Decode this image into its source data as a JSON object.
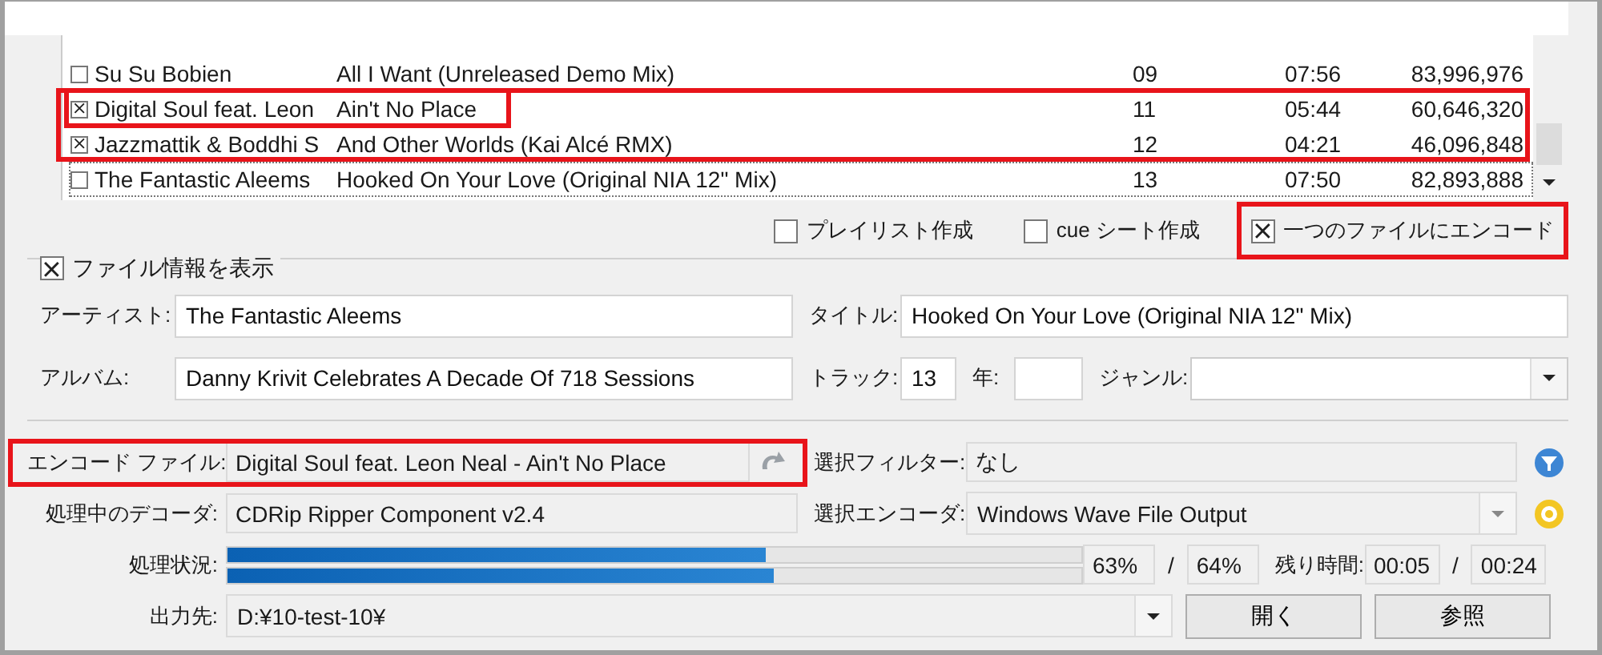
{
  "tracks": [
    {
      "checked": false,
      "marked": false,
      "emphasized": false,
      "focused": false,
      "artist": "Su Su Bobien",
      "title": "All I Want (Unreleased Demo Mix)",
      "track": "09",
      "time": "07:56",
      "size": "83,996,976"
    },
    {
      "checked": true,
      "marked": true,
      "emphasized": true,
      "focused": false,
      "artist": "Digital Soul feat. Leon",
      "title": "Ain't No Place",
      "track": "11",
      "time": "05:44",
      "size": "60,646,320"
    },
    {
      "checked": true,
      "marked": true,
      "emphasized": false,
      "focused": false,
      "artist": "Jazzmattik & Boddhi S",
      "title": "And Other Worlds (Kai Alcé RMX)",
      "track": "12",
      "time": "04:21",
      "size": "46,096,848"
    },
    {
      "checked": false,
      "marked": false,
      "emphasized": false,
      "focused": true,
      "artist": "The Fantastic Aleems",
      "title": "Hooked On Your Love (Original NIA 12\" Mix)",
      "track": "13",
      "time": "07:50",
      "size": "82,893,888"
    }
  ],
  "options": [
    {
      "label": "プレイリスト作成",
      "checked": false,
      "marked": false
    },
    {
      "label": "cue シート作成",
      "checked": false,
      "marked": false
    },
    {
      "label": "一つのファイルにエンコード",
      "checked": true,
      "marked": true
    }
  ],
  "file_info": {
    "label": "ファイル情報を表示",
    "checked": true,
    "artist": {
      "label": "アーティスト:",
      "value": "The Fantastic Aleems"
    },
    "title": {
      "label": "タイトル:",
      "value": "Hooked On Your Love (Original NIA 12\" Mix)"
    },
    "album": {
      "label": "アルバム:",
      "value": "Danny Krivit Celebrates A Decade Of 718 Sessions"
    },
    "track": {
      "label": "トラック:",
      "value": "13"
    },
    "year": {
      "label": "年:"
    },
    "genre": {
      "label": "ジャンル:"
    }
  },
  "encode_file": {
    "label": "エンコード ファイル:",
    "value": "Digital Soul feat. Leon Neal - Ain't No Place",
    "marked": true
  },
  "filter": {
    "label": "選択フィルター:",
    "value": "なし"
  },
  "decoder": {
    "label": "処理中のデコーダ:",
    "value": "CDRip Ripper Component v2.4"
  },
  "encoder": {
    "label": "選択エンコーダ:",
    "value": "Windows Wave File Output"
  },
  "progress": {
    "label": "処理状況:",
    "bars": [
      {
        "level": 0.63
      },
      {
        "level": 0.64
      }
    ],
    "percent_current": "63%",
    "separator": "/",
    "percent_total": "64%",
    "remaining_label": "残り時間:",
    "remaining_current": "00:05",
    "separator_2": "/",
    "remaining_total": "00:24"
  },
  "output": {
    "label": "出力先:",
    "value": "D:¥10-test-10¥"
  },
  "buttons": [
    "開く",
    "参照"
  ]
}
